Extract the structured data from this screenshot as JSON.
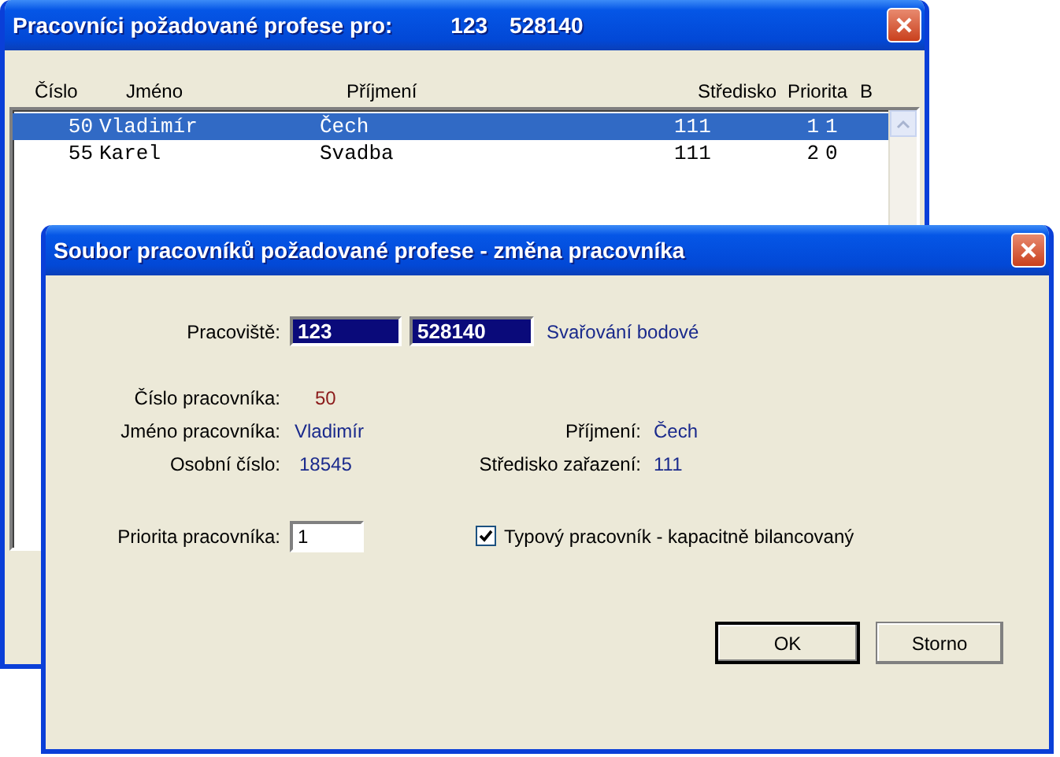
{
  "back_window": {
    "title": "Pracovníci požadované profese pro:",
    "codes": [
      "123",
      "528140"
    ],
    "columns": [
      "Číslo",
      "Jméno",
      "Příjmení",
      "Středisko",
      "Priorita",
      "B"
    ],
    "rows": [
      {
        "cells": [
          "50",
          "Vladimír",
          "Čech",
          "111",
          "1",
          "1"
        ],
        "selected": true
      },
      {
        "cells": [
          "55",
          "Karel",
          "Svadba",
          "111",
          "2",
          "0"
        ],
        "selected": false
      }
    ]
  },
  "dialog": {
    "title": "Soubor pracovníků požadované profese - změna pracovníka",
    "workplace": {
      "label": "Pracoviště:",
      "code": "123",
      "number": "528140",
      "name": "Svařování bodové"
    },
    "worker_number": {
      "label": "Číslo pracovníka:",
      "value": "50"
    },
    "first_name": {
      "label": "Jméno pracovníka:",
      "value": "Vladimír"
    },
    "surname": {
      "label": "Příjmení:",
      "value": "Čech"
    },
    "personal_number": {
      "label": "Osobní číslo:",
      "value": "18545"
    },
    "cost_center": {
      "label": "Středisko zařazení:",
      "value": "111"
    },
    "priority": {
      "label": "Priorita pracovníka:",
      "value": "1"
    },
    "typical_worker": {
      "label": "Typový pracovník - kapacitně bilancovaný",
      "checked": true
    },
    "buttons": [
      {
        "label": "OK",
        "default": true
      },
      {
        "label": "Storno",
        "default": false
      }
    ]
  }
}
